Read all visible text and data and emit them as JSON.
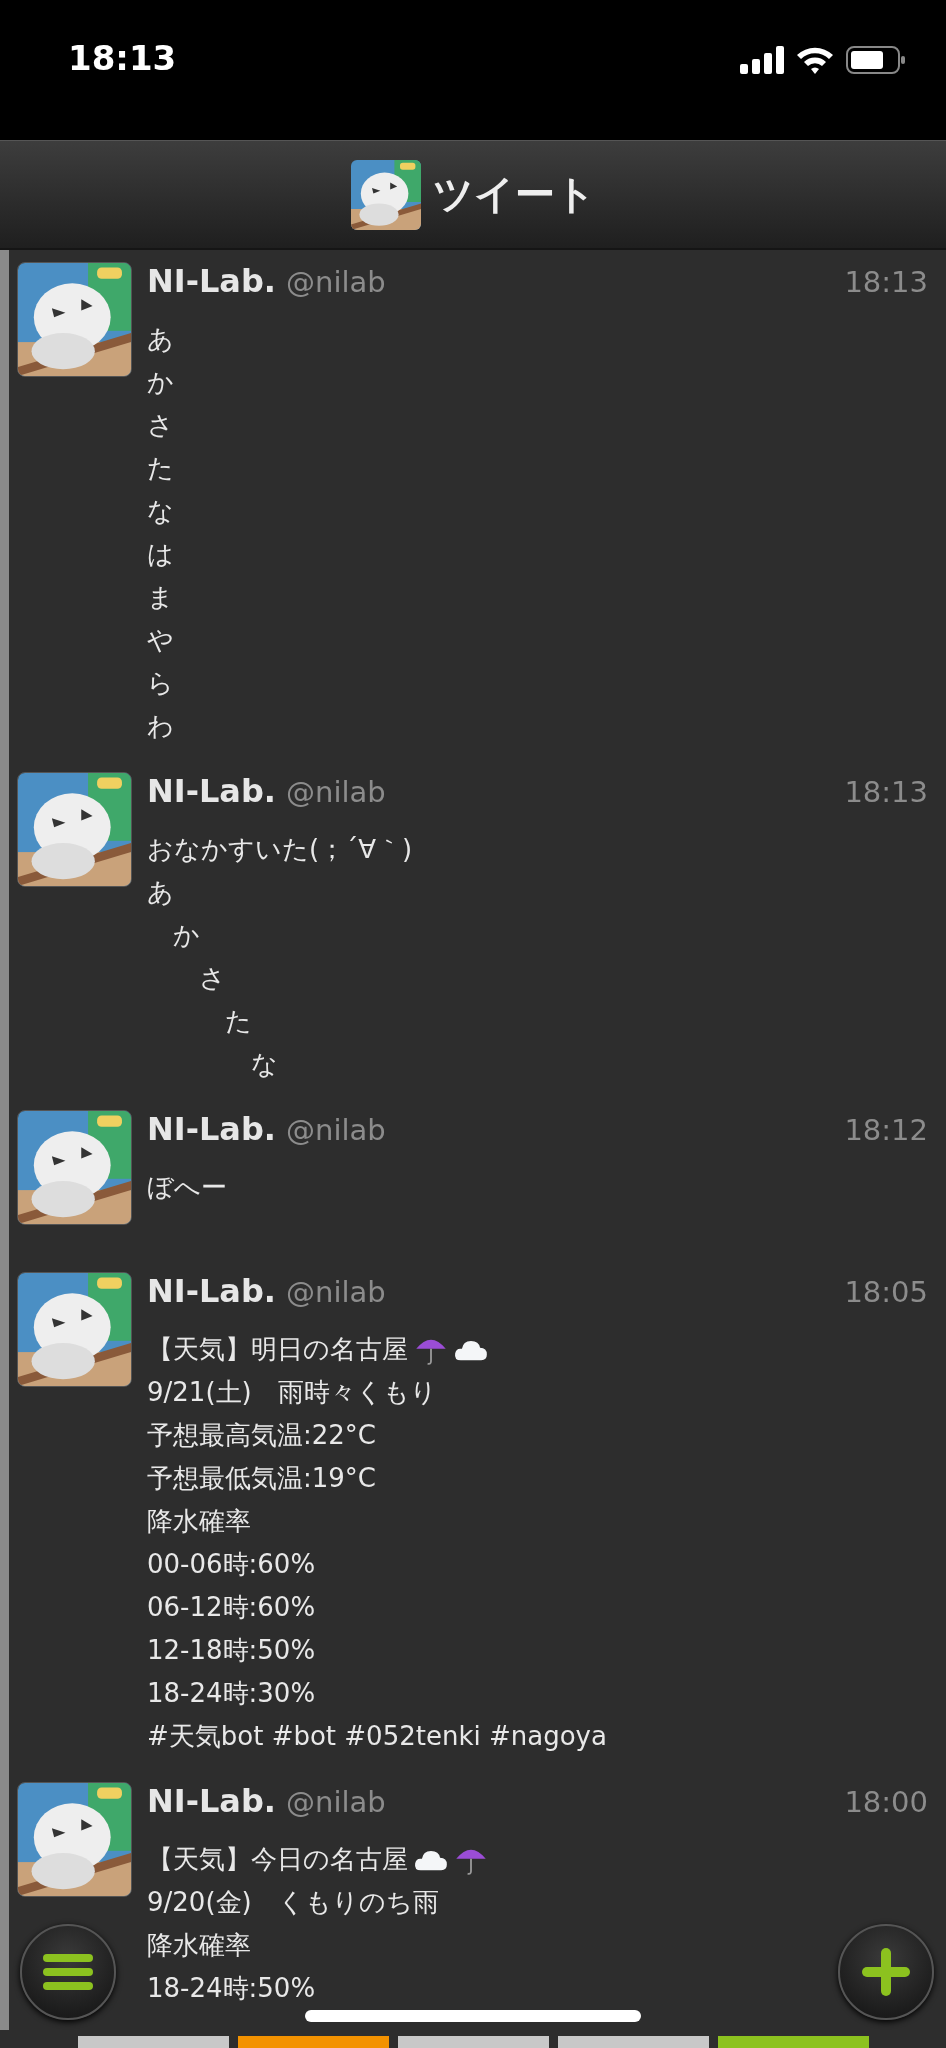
{
  "status_bar": {
    "time": "18:13"
  },
  "header": {
    "title": "ツイート"
  },
  "tweets": [
    {
      "name": "NI-Lab.",
      "handle": "@nilab",
      "time": "18:13",
      "lines": [
        "あ",
        "か",
        "さ",
        "た",
        "な",
        "は",
        "ま",
        "や",
        "ら",
        "わ"
      ]
    },
    {
      "name": "NI-Lab.",
      "handle": "@nilab",
      "time": "18:13",
      "lines": [
        "おなかすいた(；´∀｀)",
        "あ",
        "　か",
        "　　さ",
        "　　　た",
        "　　　　な"
      ]
    },
    {
      "name": "NI-Lab.",
      "handle": "@nilab",
      "time": "18:12",
      "lines": [
        "ぼへー"
      ]
    },
    {
      "name": "NI-Lab.",
      "handle": "@nilab",
      "time": "18:05",
      "emoji": [
        {
          "kind": "umbrella"
        },
        {
          "kind": "cloud"
        }
      ],
      "lines": [
        "【天気】明日の名古屋",
        "9/21(土)　雨時々くもり",
        "予想最高気温:22°C",
        "予想最低気温:19°C",
        "降水確率",
        "00-06時:60%",
        "06-12時:60%",
        "12-18時:50%",
        "18-24時:30%",
        "#天気bot #bot #052tenki #nagoya"
      ]
    },
    {
      "name": "NI-Lab.",
      "handle": "@nilab",
      "time": "18:00",
      "emoji": [
        {
          "kind": "cloud"
        },
        {
          "kind": "umbrella"
        }
      ],
      "lines": [
        "【天気】今日の名古屋",
        "9/20(金)　くもりのち雨",
        "降水確率",
        "18-24時:50%"
      ]
    }
  ],
  "page_indicator": [
    {
      "color": "#c8c8c8"
    },
    {
      "color": "#f39200"
    },
    {
      "color": "#c8c8c8"
    },
    {
      "color": "#c8c8c8"
    },
    {
      "color": "#8cc21f"
    }
  ]
}
